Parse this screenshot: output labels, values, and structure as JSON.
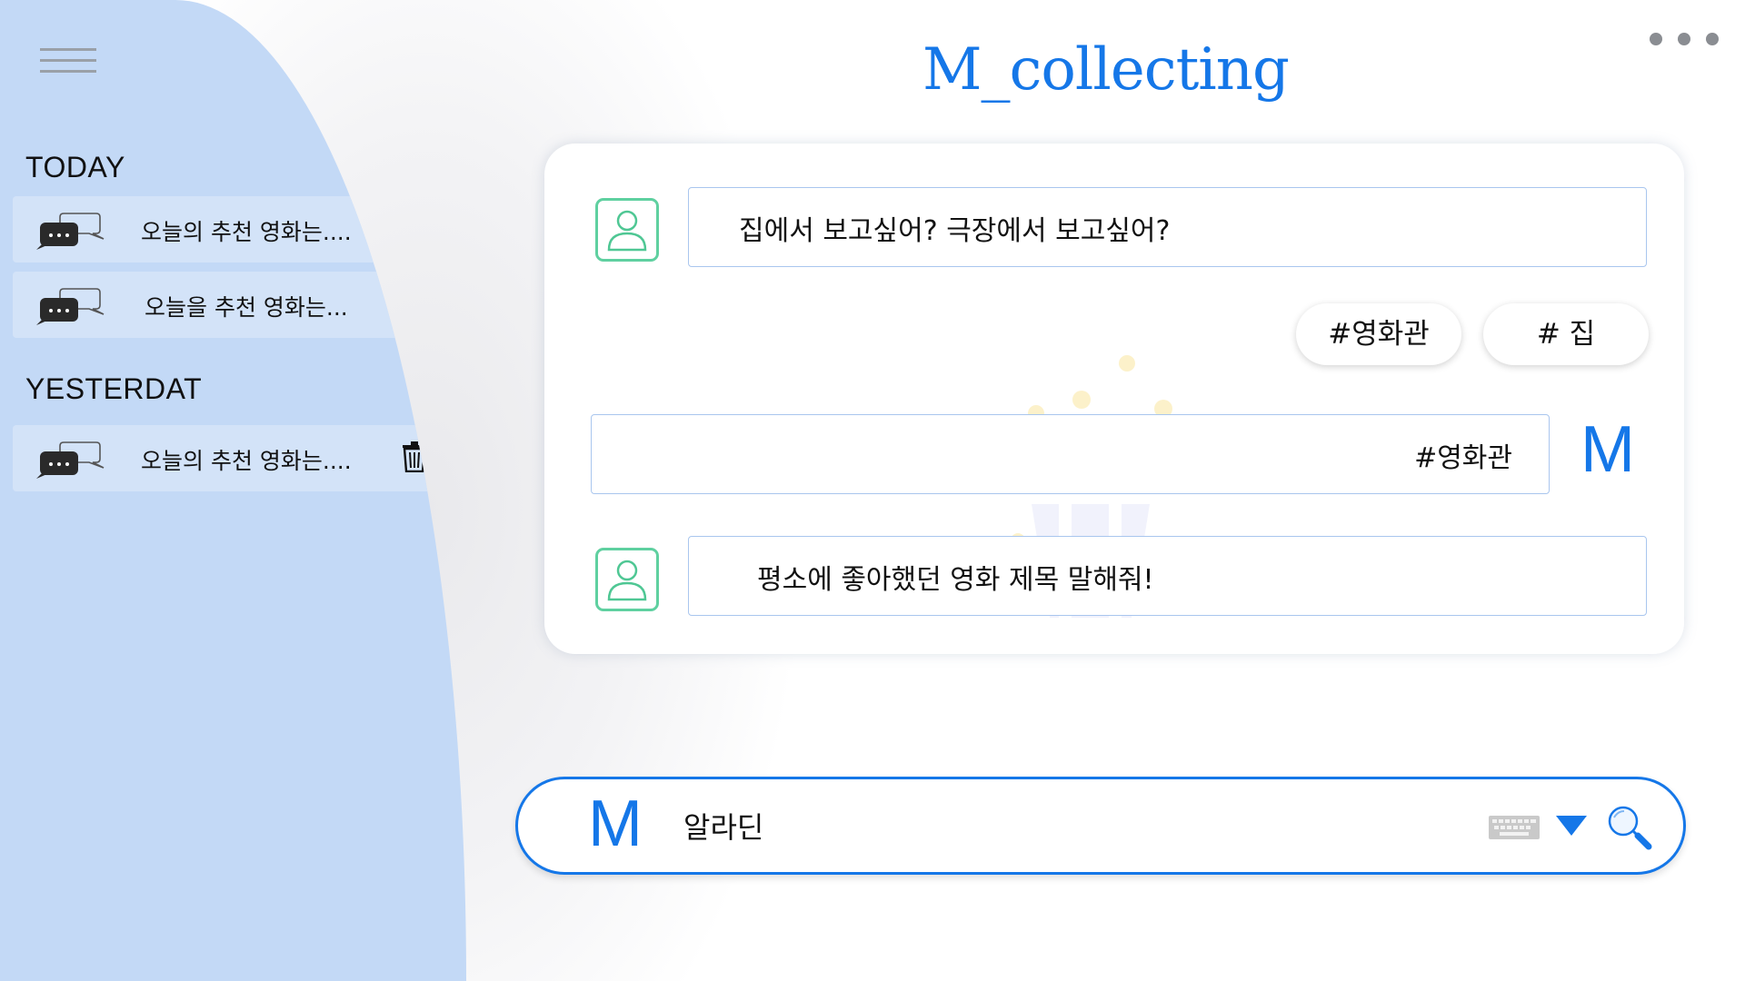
{
  "app": {
    "title": "M_collecting",
    "accent": "#1577e8",
    "sidebar_color": "#c3d9f6"
  },
  "sidebar": {
    "menu_icon": "hamburger-menu-icon",
    "sections": [
      {
        "title": "TODAY",
        "items": [
          {
            "label": "오늘의 추천 영화는....",
            "icon": "chat-bubble-icon",
            "action_icon": "trash-icon"
          },
          {
            "label": "오늘을 추천 영화는...",
            "icon": "chat-bubble-icon",
            "action_icon": "trash-icon"
          }
        ]
      },
      {
        "title": "YESTERDAT",
        "items": [
          {
            "label": "오늘의 추천 영화는....",
            "icon": "chat-bubble-icon",
            "action_icon": "trash-icon"
          }
        ]
      }
    ]
  },
  "header": {
    "more_icon": "more-dots-icon"
  },
  "chat": {
    "messages": [
      {
        "sender": "bot",
        "text": "집에서 보고싶어? 극장에서 보고싶어?",
        "icon": "user-avatar-icon"
      },
      {
        "sender": "user",
        "text": "#영화관",
        "logo": "M"
      },
      {
        "sender": "bot",
        "text": "평소에 좋아했던 영화 제목 말해줘!",
        "icon": "user-avatar-icon"
      }
    ],
    "quick_replies": [
      "#영화관",
      "# 집"
    ],
    "background_icon": "popcorn-icon"
  },
  "search": {
    "logo": "M",
    "value": "알라딘",
    "icons": [
      "keyboard-icon",
      "dropdown-arrow-icon",
      "search-icon"
    ]
  }
}
